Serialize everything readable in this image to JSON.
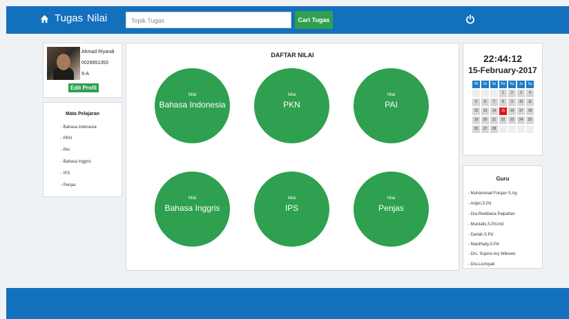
{
  "navbar": {
    "home_icon": "home-icon",
    "link_tugas": "Tugas",
    "link_nilai": "Nilai",
    "search_placeholder": "Topik Tugas",
    "search_button": "Cari Tugas",
    "power_icon": "power-icon"
  },
  "profile": {
    "name": "Ahmad Riyandi",
    "nis": "0029851353",
    "class": "9-A",
    "edit_button": "Edit Profil"
  },
  "subjects": {
    "title": "Mata Pelajaran",
    "items": [
      "- Bahasa Indonesia",
      "- PKN",
      "- PAI",
      "- Bahasa Inggris",
      "- IPS",
      "- Penjas"
    ]
  },
  "grades": {
    "title": "DAFTAR NILAI",
    "items": [
      {
        "label": "Nilai",
        "subject": "Bahasa Indonesia"
      },
      {
        "label": "Nilai",
        "subject": "PKN"
      },
      {
        "label": "Nilai",
        "subject": "PAI"
      },
      {
        "label": "Nilai",
        "subject": "Bahasa Inggris"
      },
      {
        "label": "Nilai",
        "subject": "IPS"
      },
      {
        "label": "Nilai",
        "subject": "Penjas"
      }
    ]
  },
  "clock": {
    "time": "22:44:12",
    "date": "15-February-2017",
    "weekdays": [
      "Mi",
      "Se",
      "Se",
      "Ra",
      "Ka",
      "Ju",
      "Sa"
    ],
    "rows": [
      [
        "",
        "",
        "",
        "1",
        "2",
        "3",
        "4"
      ],
      [
        "5",
        "6",
        "7",
        "8",
        "9",
        "10",
        "11"
      ],
      [
        "12",
        "13",
        "14",
        "15",
        "16",
        "17",
        "18"
      ],
      [
        "19",
        "20",
        "21",
        "22",
        "23",
        "24",
        "25"
      ],
      [
        "26",
        "27",
        "28",
        "",
        "",
        "",
        ""
      ]
    ],
    "today": "15",
    "today_color": "#e01515"
  },
  "teachers": {
    "title": "Guru",
    "items": [
      "- Muhammad Furqan S.Ag",
      "- Aripin,S.Pd",
      "- Dra.Reddiana Paipahan",
      "- Murdalis,S.Pd.Ind",
      "- Darlah,S.Pd",
      "- Mardhiaty,S.Pd",
      "- Drs. Sujono Ary Wibowo",
      "- Dra.Lismiyati"
    ]
  },
  "colors": {
    "primary": "#1370bd",
    "accent_green": "#2ea04f",
    "background": "#eef2f5"
  }
}
